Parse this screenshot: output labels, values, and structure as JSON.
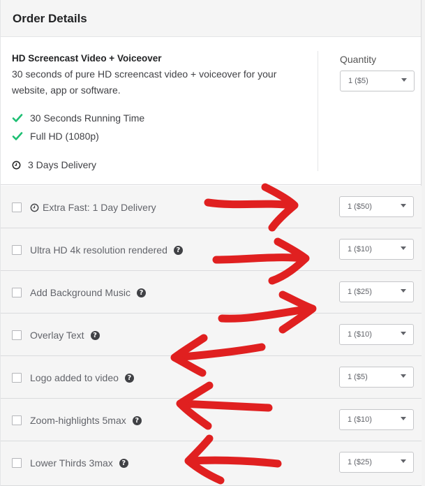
{
  "header": {
    "title": "Order Details"
  },
  "package": {
    "title": "HD Screencast Video + Voiceover",
    "description": "30 seconds of pure HD screencast video + voiceover for your website, app or software.",
    "features": [
      "30 Seconds Running Time",
      "Full HD (1080p)"
    ],
    "delivery": "3 Days Delivery",
    "quantity_label": "Quantity",
    "quantity_value": "1 ($5)"
  },
  "extras": [
    {
      "label": "Extra Fast: 1 Day Delivery",
      "price": "1 ($50)",
      "icon": "clock-icon",
      "help": false
    },
    {
      "label": "Ultra HD 4k resolution rendered",
      "price": "1 ($10)",
      "help": true
    },
    {
      "label": "Add Background Music",
      "price": "1 ($25)",
      "help": true
    },
    {
      "label": "Overlay Text",
      "price": "1 ($10)",
      "help": true
    },
    {
      "label": "Logo added to video",
      "price": "1 ($5)",
      "help": true
    },
    {
      "label": "Zoom-highlights 5max",
      "price": "1 ($10)",
      "help": true
    },
    {
      "label": "Lower Thirds 3max",
      "price": "1 ($25)",
      "help": true
    }
  ],
  "help_glyph": "?",
  "colors": {
    "check": "#1dbf73",
    "annotation": "#e02020"
  },
  "annotations": [
    "red-arrow-right",
    "red-arrow-right",
    "red-arrow-right",
    "red-arrow-left",
    "red-arrow-left",
    "red-arrow-left"
  ]
}
